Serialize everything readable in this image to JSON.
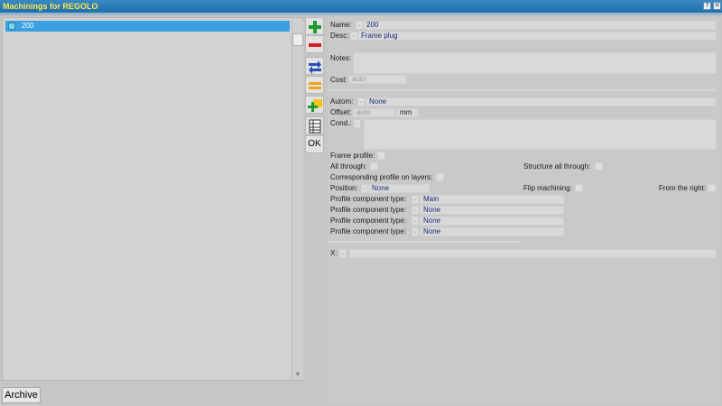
{
  "window": {
    "title": "Machinings for REGOLO"
  },
  "list": {
    "items": [
      {
        "label": "200",
        "icon": "cell-icon"
      }
    ]
  },
  "toolbar": {
    "buttons": [
      {
        "name": "add-button",
        "icon": "green-plus-icon"
      },
      {
        "name": "delete-button",
        "icon": "red-minus-icon"
      },
      {
        "name": "swap-button",
        "icon": "blue-arrows-icon"
      },
      {
        "name": "equal-button",
        "icon": "orange-equal-icon"
      },
      {
        "name": "add-copy-button",
        "icon": "plus-copy-icon"
      },
      {
        "name": "table-button",
        "icon": "table-icon"
      }
    ],
    "ok_label": "OK"
  },
  "form": {
    "name_label": "Name:",
    "name_value": "200",
    "desc_label": "Desc:",
    "desc_value": "Frame plug",
    "notes_label": "Notes:",
    "cost_label": "Cost:",
    "cost_placeholder": "auto",
    "autom_label": "Autom:",
    "autom_value": "None",
    "offset_label": "Offset:",
    "offset_placeholder": "auto",
    "offset_unit": "mm",
    "cond_label": "Cond.:",
    "frame_profile_label": "Frame profile:",
    "all_through_label": "All through:",
    "structure_all_through_label": "Structure all through:",
    "corresponding_profile_label": "Corresponding profile on layers:",
    "position_label": "Position:",
    "position_value": "None",
    "flip_machining_label": "Flip machining:",
    "from_right_label": "From the right:",
    "profile_components": [
      {
        "label": "Profile component type:",
        "value": "Main"
      },
      {
        "label": "Profile component type:",
        "value": "None"
      },
      {
        "label": "Profile component type:",
        "value": "None"
      },
      {
        "label": "Profile component type:",
        "value": "None"
      }
    ],
    "x_label": "X:",
    "dropdown_glyph": "⌄"
  },
  "archive_label": "Archive",
  "colors": {
    "title_bar": "#2a7cbb",
    "title_text": "#ffe94a",
    "selection": "#3aa0df"
  }
}
